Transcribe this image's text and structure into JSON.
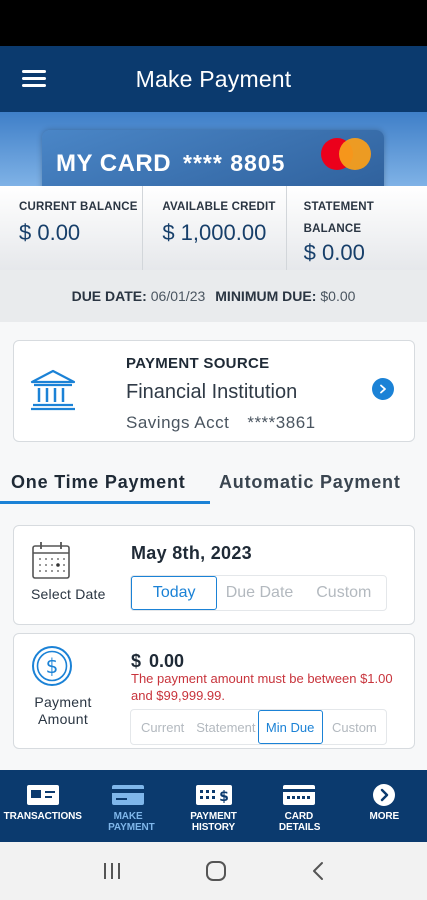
{
  "header": {
    "title": "Make Payment"
  },
  "card": {
    "name": "MY CARD",
    "number": "**** 8805"
  },
  "balances": [
    {
      "label": "CURRENT BALANCE",
      "value": "$ 0.00"
    },
    {
      "label": "AVAILABLE CREDIT",
      "value": "$ 1,000.00"
    },
    {
      "label": "STATEMENT BALANCE",
      "value": "$ 0.00"
    }
  ],
  "due": {
    "due_date_label": "DUE DATE:",
    "due_date": "06/01/23",
    "min_due_label": "MINIMUM DUE:",
    "min_due": "$0.00"
  },
  "payment_source": {
    "title": "PAYMENT SOURCE",
    "institution": "Financial Institution",
    "account_type": "Savings Acct",
    "account_number": "****3861"
  },
  "tabs": [
    "One Time Payment",
    "Automatic Payment"
  ],
  "select_date": {
    "label": "Select Date",
    "value": "May 8th, 2023",
    "options": [
      "Today",
      "Due Date",
      "Custom"
    ],
    "selected": "Today"
  },
  "payment_amount": {
    "label": "Payment Amount",
    "currency": "$",
    "value": "0.00",
    "error": "The payment amount must be between $1.00 and $99,999.99.",
    "options": [
      "Current",
      "Statement",
      "Min Due",
      "Custom"
    ],
    "selected": "Min Due"
  },
  "bottom_nav": [
    {
      "label": "TRANSACTIONS",
      "icon": "transactions-icon"
    },
    {
      "label": "MAKE PAYMENT",
      "icon": "make-payment-icon",
      "active": true
    },
    {
      "label": "PAYMENT HISTORY",
      "icon": "payment-history-icon"
    },
    {
      "label": "CARD DETAILS",
      "icon": "card-details-icon"
    },
    {
      "label": "MORE",
      "icon": "more-icon"
    }
  ],
  "colors": {
    "primary": "#0b3a6e",
    "accent": "#1b82d6",
    "error": "#c8343c"
  }
}
